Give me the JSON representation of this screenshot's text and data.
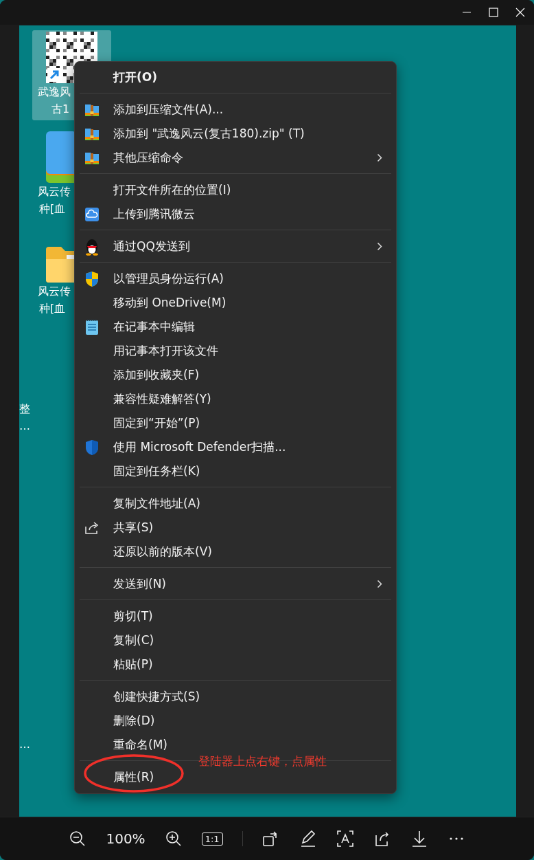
{
  "desktop_icons": [
    {
      "kind": "shortcut",
      "selected": true,
      "label_lines": [
        "武逸风",
        "古1"
      ]
    },
    {
      "kind": "zip",
      "selected": false,
      "label_lines": [
        "风云传",
        "种[血"
      ]
    },
    {
      "kind": "folder",
      "selected": false,
      "label_lines": [
        "风云传",
        "种[血"
      ]
    }
  ],
  "edge_labels": [
    [
      "整",
      "…"
    ],
    [
      "…"
    ]
  ],
  "context_menu": {
    "groups": [
      [
        {
          "label": "打开(O)",
          "default": true,
          "submenu": false
        }
      ],
      [
        {
          "label": "添加到压缩文件(A)...",
          "kind": "archive",
          "default": false,
          "submenu": false
        },
        {
          "label": "添加到 \"武逸风云(复古180).zip\" (T)",
          "kind": "archive",
          "default": false,
          "submenu": false
        },
        {
          "label": "其他压缩命令",
          "kind": "archive",
          "default": false,
          "submenu": true
        }
      ],
      [
        {
          "label": "打开文件所在的位置(I)",
          "default": false,
          "submenu": false
        },
        {
          "label": "上传到腾讯微云",
          "kind": "cloud",
          "default": false,
          "submenu": false
        }
      ],
      [
        {
          "label": "通过QQ发送到",
          "kind": "penguin",
          "default": false,
          "submenu": true
        }
      ],
      [
        {
          "label": "以管理员身份运行(A)",
          "kind": "uac",
          "default": false,
          "submenu": false
        },
        {
          "label": "移动到 OneDrive(M)",
          "default": false,
          "submenu": false
        },
        {
          "label": "在记事本中编辑",
          "kind": "notepad",
          "default": false,
          "submenu": false
        },
        {
          "label": "用记事本打开该文件",
          "default": false,
          "submenu": false
        },
        {
          "label": "添加到收藏夹(F)",
          "default": false,
          "submenu": false
        },
        {
          "label": "兼容性疑难解答(Y)",
          "default": false,
          "submenu": false
        },
        {
          "label": "固定到“开始”(P)",
          "default": false,
          "submenu": false
        },
        {
          "label": "使用 Microsoft Defender扫描...",
          "kind": "defender",
          "default": false,
          "submenu": false
        },
        {
          "label": "固定到任务栏(K)",
          "default": false,
          "submenu": false
        }
      ],
      [
        {
          "label": "复制文件地址(A)",
          "default": false,
          "submenu": false
        },
        {
          "label": "共享(S)",
          "kind": "share",
          "default": false,
          "submenu": false
        },
        {
          "label": "还原以前的版本(V)",
          "default": false,
          "submenu": false
        }
      ],
      [
        {
          "label": "发送到(N)",
          "default": false,
          "submenu": true
        }
      ],
      [
        {
          "label": "剪切(T)",
          "default": false,
          "submenu": false
        },
        {
          "label": "复制(C)",
          "default": false,
          "submenu": false
        },
        {
          "label": "粘贴(P)",
          "default": false,
          "submenu": false
        }
      ],
      [
        {
          "label": "创建快捷方式(S)",
          "default": false,
          "submenu": false
        },
        {
          "label": "删除(D)",
          "default": false,
          "submenu": false
        },
        {
          "label": "重命名(M)",
          "default": false,
          "submenu": false
        }
      ],
      [
        {
          "label": "属性(R)",
          "default": false,
          "submenu": false
        }
      ]
    ]
  },
  "annotation": {
    "text": "登陆器上点右键，点属性"
  },
  "toolbar": {
    "zoom": "100%",
    "actual_size": "1:1"
  }
}
